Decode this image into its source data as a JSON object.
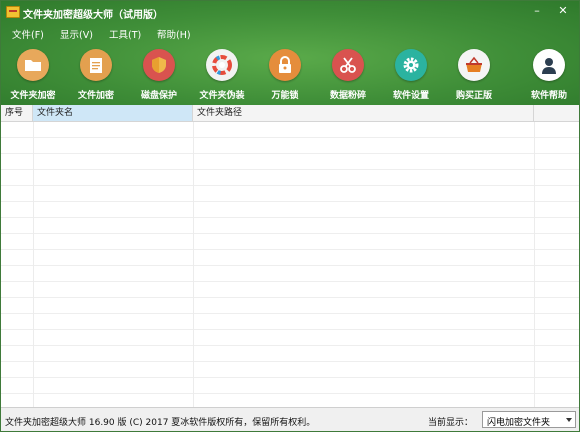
{
  "window": {
    "title": "文件夹加密超级大师（试用版）",
    "controls": [
      "–",
      "✕"
    ]
  },
  "menu": [
    "文件(F)",
    "显示(V)",
    "工具(T)",
    "帮助(H)"
  ],
  "toolbar": [
    {
      "label": "文件夹加密",
      "icon": "folder-icon",
      "color": "#e8a85b"
    },
    {
      "label": "文件加密",
      "icon": "document-icon",
      "color": "#e3a04f"
    },
    {
      "label": "磁盘保护",
      "icon": "shield-icon",
      "color": "#d9534f"
    },
    {
      "label": "文件夹伪装",
      "icon": "color-wheel-icon",
      "color": "#f2f2f2"
    },
    {
      "label": "万能锁",
      "icon": "lock-icon",
      "color": "#e58d3c"
    },
    {
      "label": "数据粉碎",
      "icon": "scissors-icon",
      "color": "#d9534f"
    },
    {
      "label": "软件设置",
      "icon": "gear-icon",
      "color": "#2bb3a0"
    },
    {
      "label": "购买正版",
      "icon": "basket-icon",
      "color": "#f4f4f4"
    },
    {
      "label": "软件帮助",
      "icon": "user-help-icon",
      "color": "#ffffff"
    }
  ],
  "table": {
    "columns": [
      "序号",
      "文件夹名",
      "文件夹路径"
    ]
  },
  "status": {
    "text": "文件夹加密超级大师 16.90 版 (C) 2017  夏冰软件版权所有，保留所有权利。",
    "current_label": "当前显示：",
    "current_value": "闪电加密文件夹"
  }
}
